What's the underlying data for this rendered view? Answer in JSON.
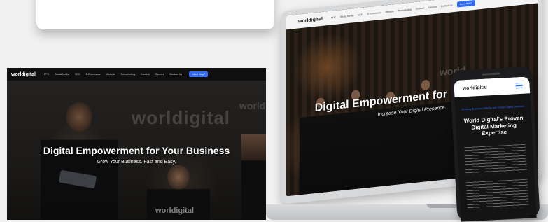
{
  "brand": {
    "logo": "worldigital",
    "accent": "#2f6df6"
  },
  "nav": {
    "items": [
      "PPC",
      "Social Media",
      "SEO",
      "E-Commerce",
      "Website",
      "Remarketing",
      "Content",
      "Careers",
      "Contact Us"
    ],
    "cta": "Need Help?"
  },
  "desktop": {
    "headline": "Digital Empowerment for Your Business",
    "subline": "Grow Your Business. Fast and Easy.",
    "wall_text": "worldigital",
    "wall_text_2": "world",
    "shirt_text": "worldigital"
  },
  "laptop": {
    "headline": "Digital Empowerment for Your Busin",
    "subline": "Increase Your Digital Presence.",
    "wall_text": "world"
  },
  "phone": {
    "eyebrow": "Growing Business Visibility with Proven Digital Solutions",
    "title": "World Digital's Proven Digital Marketing Expertise"
  }
}
